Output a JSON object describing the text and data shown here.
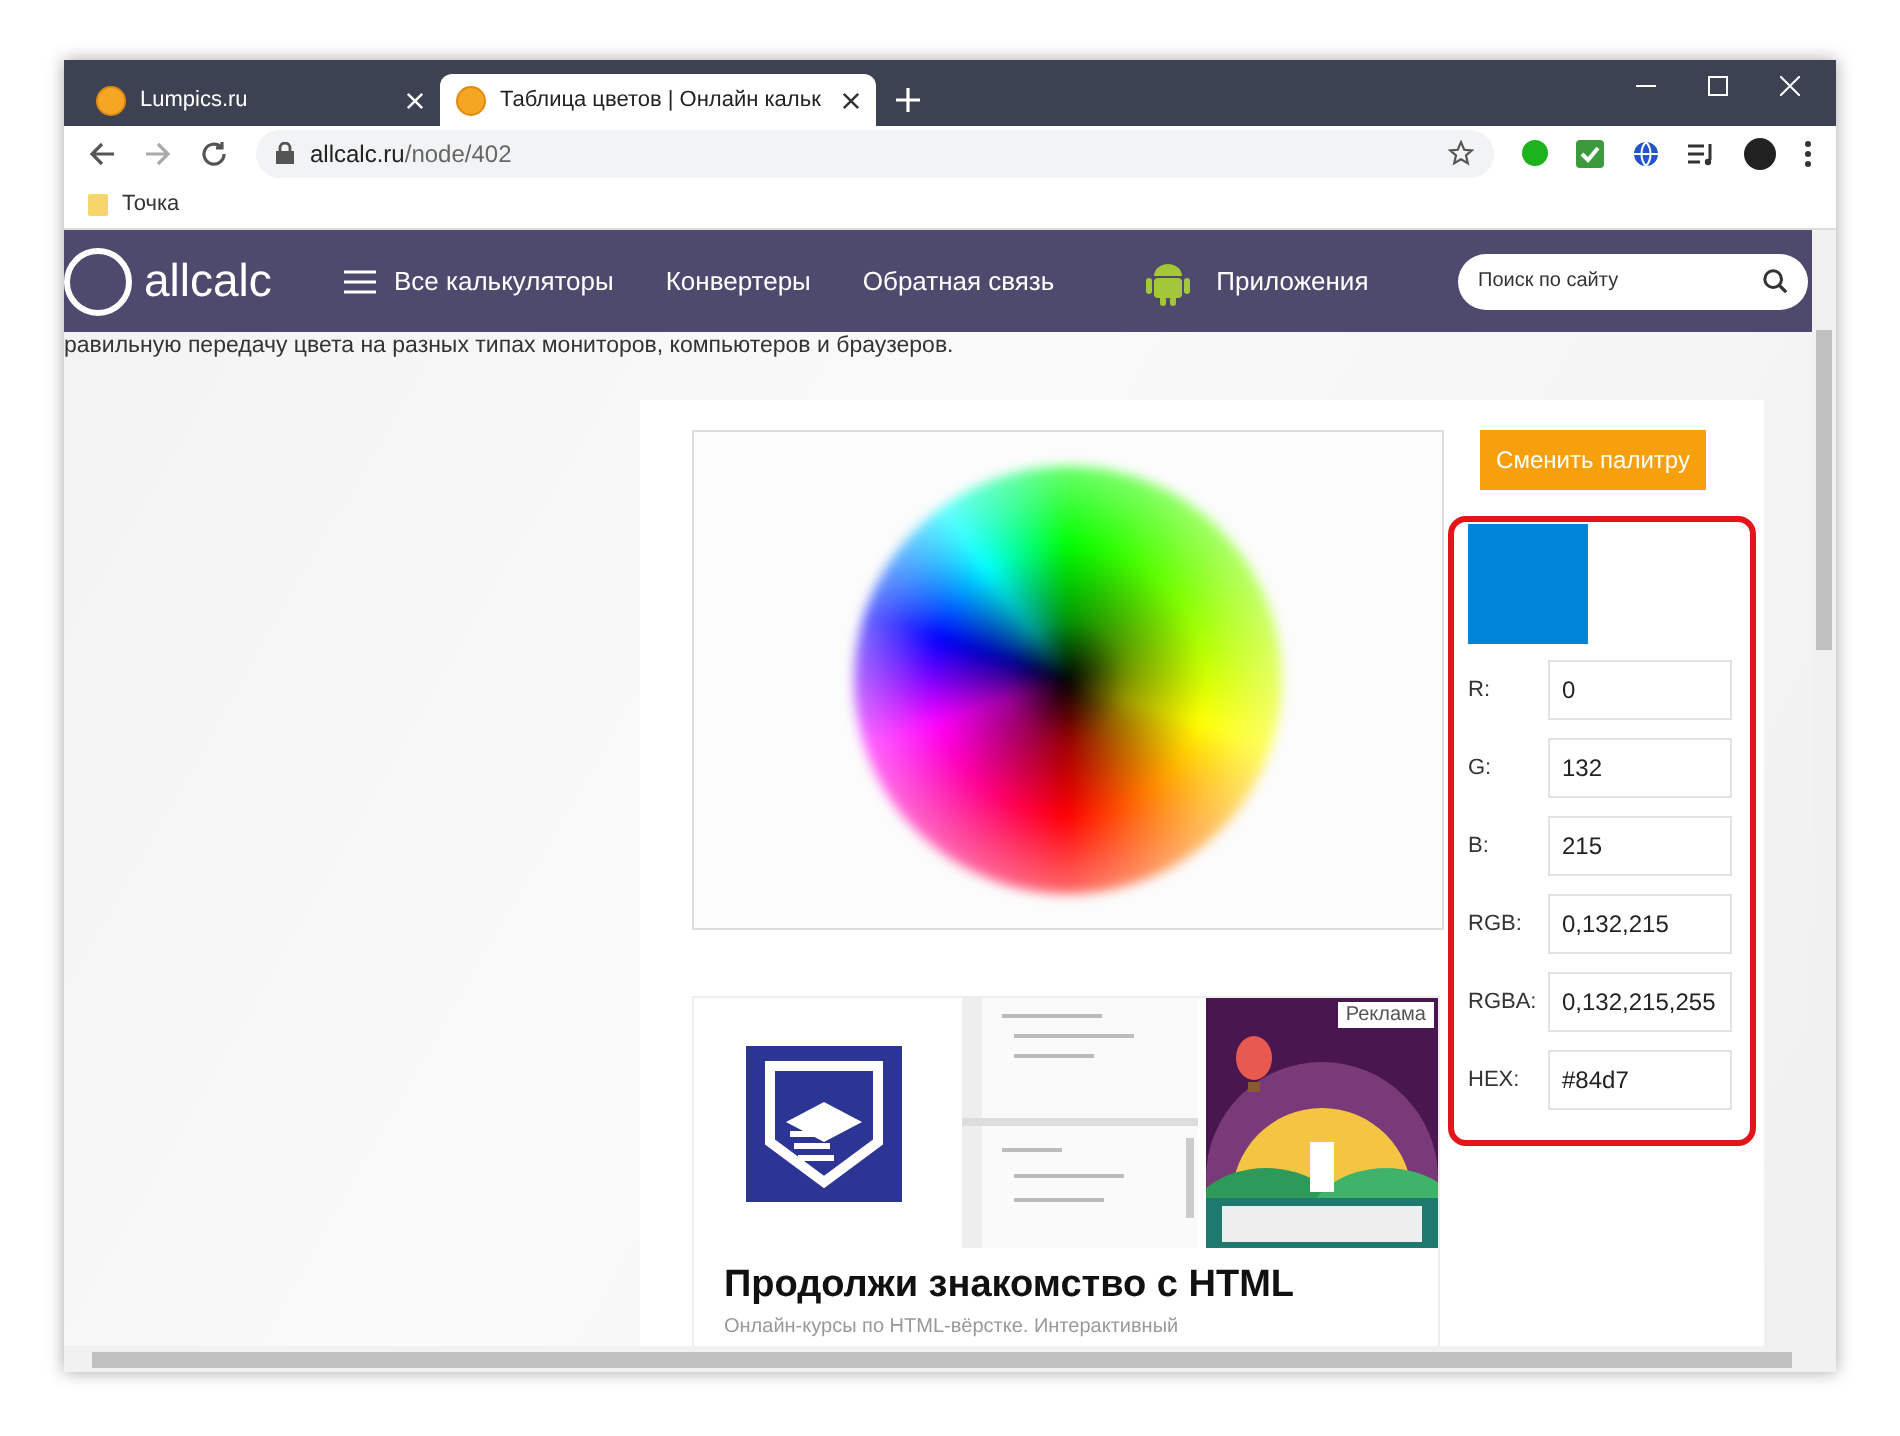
{
  "browser": {
    "tabs": [
      {
        "title": "Lumpics.ru",
        "selected": false
      },
      {
        "title": "Таблица цветов | Онлайн кальк",
        "selected": true
      }
    ],
    "address": {
      "host": "allcalc.ru",
      "path": "/node/402"
    },
    "bookmarks": [
      "Точка"
    ]
  },
  "site_header": {
    "logo": "allcalc",
    "nav": [
      {
        "label": "Все калькуляторы",
        "kind": "menu"
      },
      {
        "label": "Конвертеры",
        "kind": "link"
      },
      {
        "label": "Обратная связь",
        "kind": "link"
      },
      {
        "label": "Приложения",
        "kind": "apps"
      }
    ],
    "search": {
      "placeholder": "Поиск по сайту"
    }
  },
  "intro": "равильную передачу цвета на разных типах мониторов, компьютеров и браузеров.",
  "picker": {
    "button": "Сменить палитру",
    "fields": [
      {
        "label": "R:",
        "value": "0"
      },
      {
        "label": "G:",
        "value": "132"
      },
      {
        "label": "B:",
        "value": "215"
      },
      {
        "label": "RGB:",
        "value": "0,132,215"
      },
      {
        "label": "RGBA:",
        "value": "0,132,215,255"
      },
      {
        "label": "HEX:",
        "value": "#84d7"
      }
    ]
  },
  "ad": {
    "badge": "Реклама",
    "title": "Продолжи знакомство с HTML",
    "text": "Онлайн-курсы по HTML-вёрстке. Интерактивный"
  }
}
